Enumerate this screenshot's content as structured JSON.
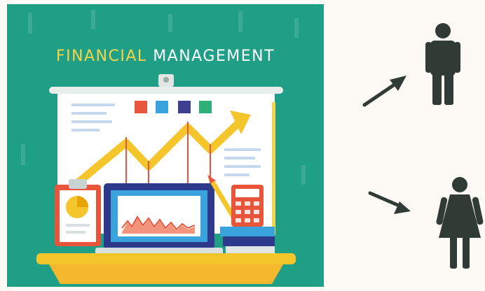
{
  "poster": {
    "title_accent": "FINANCIAL",
    "title_rest": "MANAGEMENT"
  },
  "colors": {
    "poster_background": "#1f9f86",
    "title_accent": "#f5d44b",
    "figure": "#2f3b34",
    "squares": [
      "#e9553b",
      "#3aa3dc",
      "#3d3f8f",
      "#2fb07a"
    ]
  },
  "icons": {
    "arrows": [
      "arrow-up-right-icon",
      "arrow-down-right-icon"
    ],
    "figures": [
      "man-icon",
      "woman-icon"
    ]
  }
}
